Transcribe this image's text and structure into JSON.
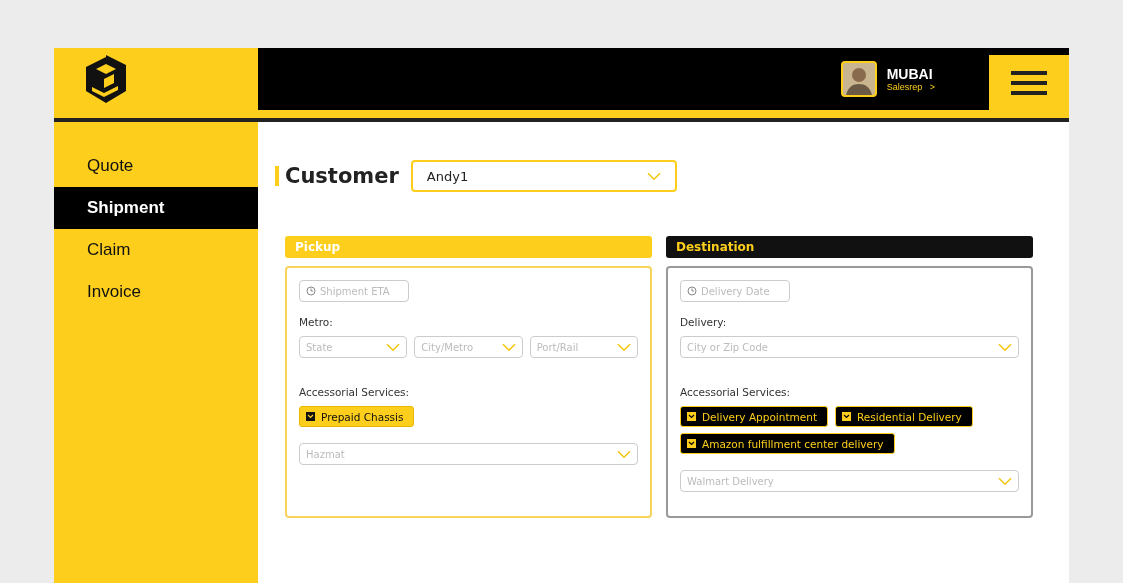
{
  "user": {
    "name": "MUBAI",
    "role": "Salesrep",
    "role_arrow": ">"
  },
  "nav": [
    {
      "label": "Quote",
      "selected": false
    },
    {
      "label": "Shipment",
      "selected": true
    },
    {
      "label": "Claim",
      "selected": false
    },
    {
      "label": "Invoice",
      "selected": false
    }
  ],
  "customer": {
    "label": "Customer",
    "value": "Andy1"
  },
  "panels": [
    {
      "title": "Pickup",
      "kind": "accent",
      "date_placeholder": "Shipment ETA",
      "location_label": "Metro:",
      "location_fields": [
        {
          "placeholder": "State"
        },
        {
          "placeholder": "City/Metro"
        },
        {
          "placeholder": "Port/Rail"
        }
      ],
      "services_label": "Accessorial Services:",
      "services": [
        {
          "label": "Prepaid Chassis",
          "checked": true
        }
      ],
      "extra_select": {
        "placeholder": "Hazmat"
      }
    },
    {
      "title": "Destination",
      "kind": "dark",
      "date_placeholder": "Delivery Date",
      "location_label": "Delivery:",
      "location_fields": [
        {
          "placeholder": "City or Zip Code"
        }
      ],
      "services_label": "Accessorial Services:",
      "services": [
        {
          "label": "Delivery Appointment",
          "checked": true
        },
        {
          "label": "Residential Delivery",
          "checked": true
        },
        {
          "label": "Amazon fulfillment center delivery",
          "checked": true
        }
      ],
      "extra_select": {
        "placeholder": "Walmart Delivery"
      }
    }
  ]
}
